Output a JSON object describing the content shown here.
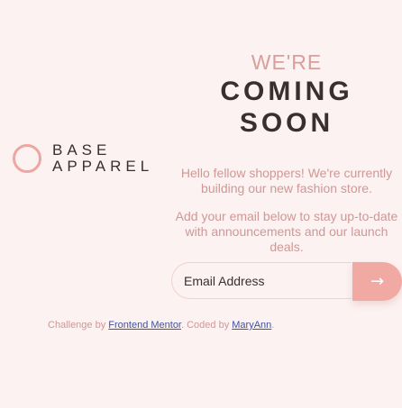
{
  "brand": {
    "line1": "BASE",
    "line2": "APPAREL"
  },
  "hero": {
    "pre_title": "WE'RE",
    "title_line1": "COMING",
    "title_line2": "SOON",
    "paragraph1": "Hello fellow shoppers! We're currently building our new fashion store.",
    "paragraph2": "Add your email below to stay up-to-date with announcements and our launch deals."
  },
  "form": {
    "email_placeholder": "Email Address",
    "email_value": "",
    "submit_icon": "arrow-right-icon",
    "submit_glyph": "→"
  },
  "attribution": {
    "prefix": "Challenge by",
    "link1": "Frontend Mentor",
    "middle": ". Coded by",
    "link2": "MaryAnn",
    "suffix": "."
  },
  "colors": {
    "background": "#fcf2f1",
    "accent": "#f1a9a4",
    "text_dark": "#3b2e2f",
    "text_pink": "#ce9896",
    "link": "#3e52a3"
  }
}
